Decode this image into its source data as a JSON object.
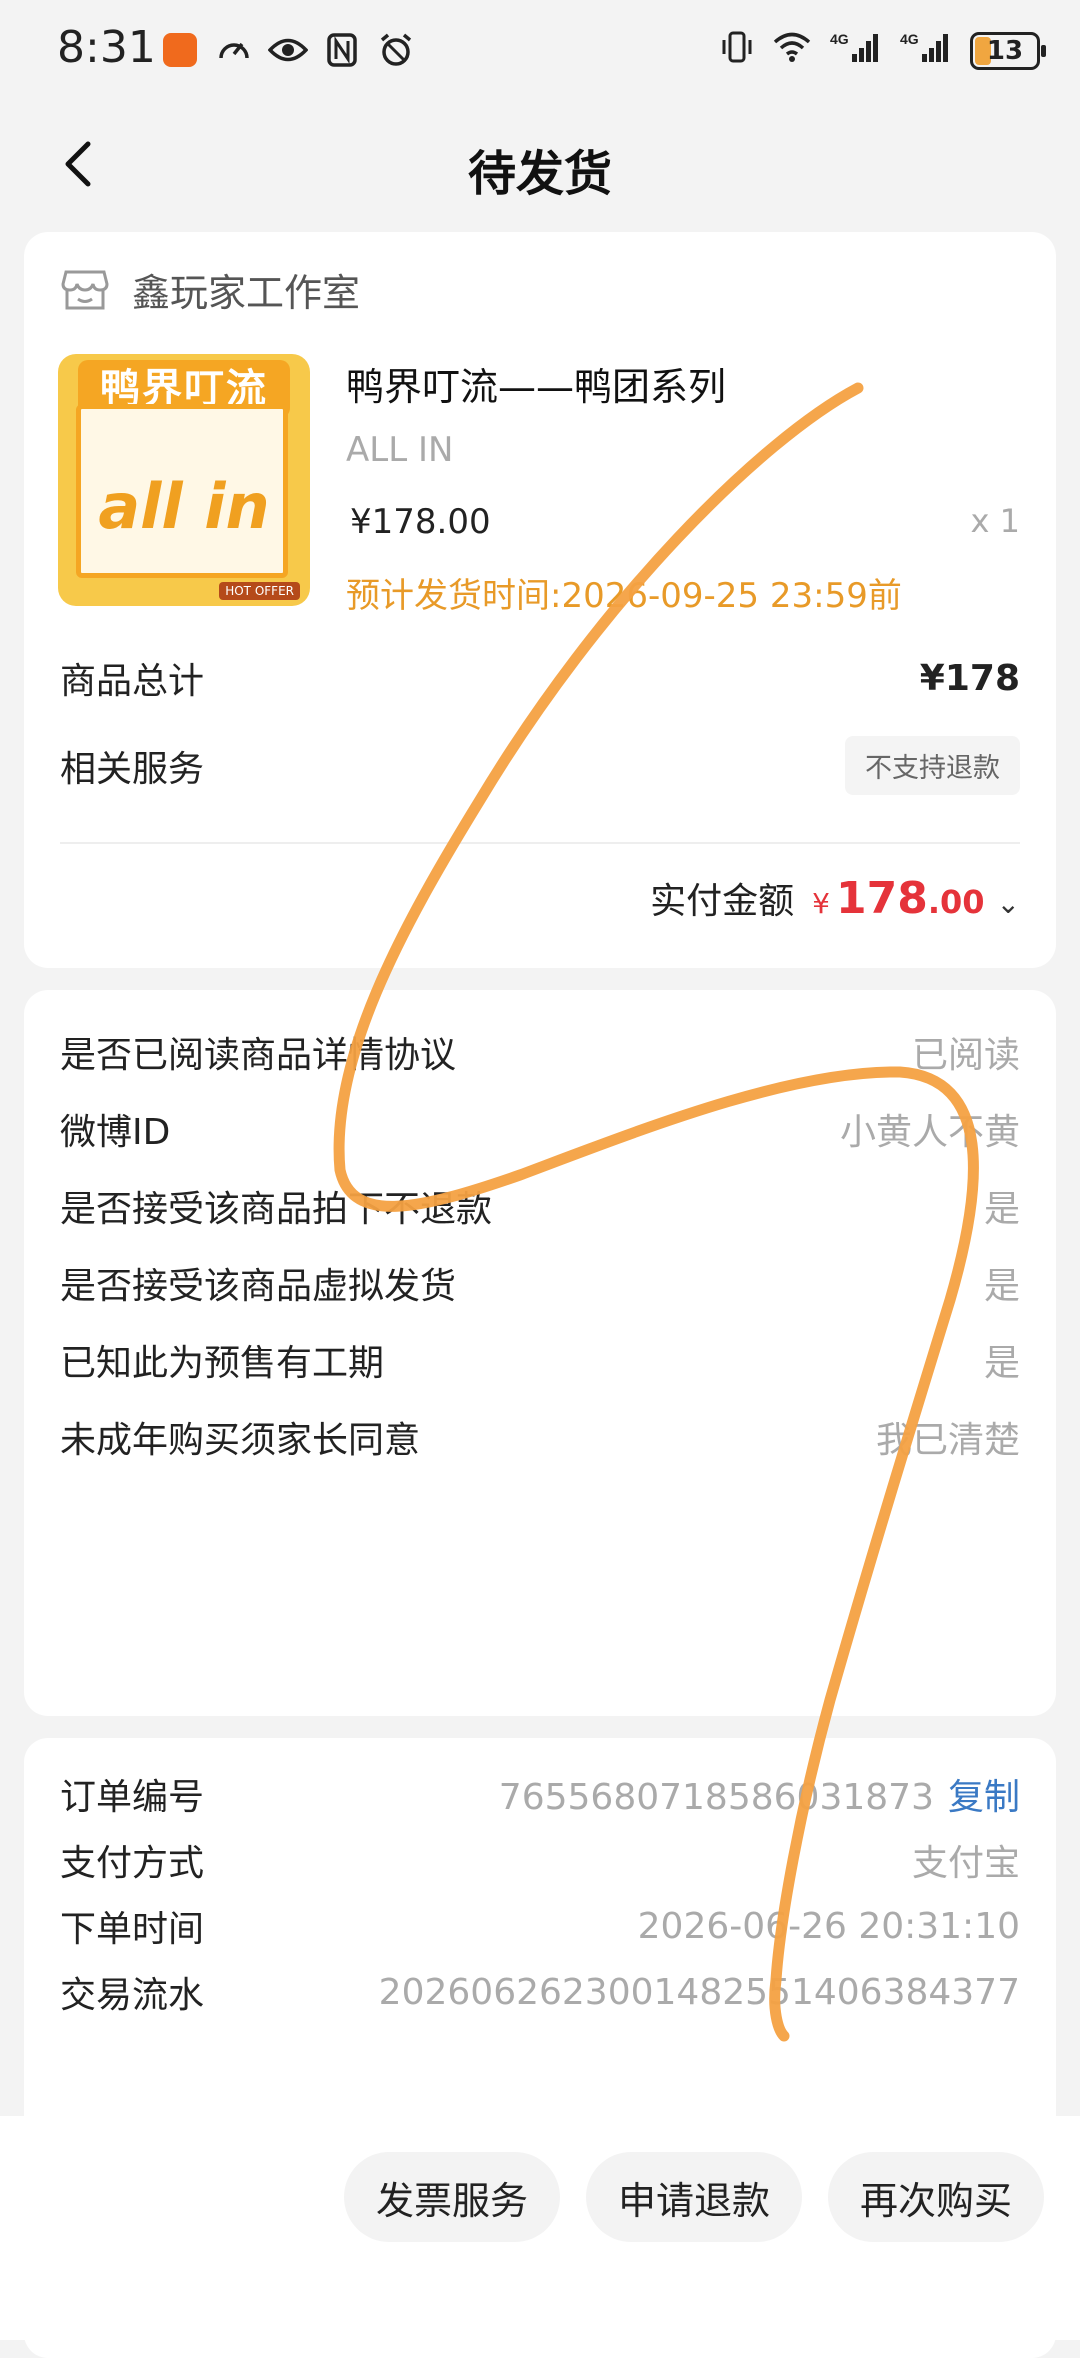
{
  "status_bar": {
    "time": "8:31",
    "network": "4G",
    "battery": "13",
    "icons": [
      "app-icon",
      "speedometer-icon",
      "eye-icon",
      "nfc-icon",
      "alarm-icon",
      "vibrate-icon",
      "wifi-icon",
      "signal-icon",
      "battery-icon"
    ]
  },
  "header": {
    "title": "待发货"
  },
  "order": {
    "shop_name": "鑫玩家工作室",
    "product": {
      "image_banner": "鸭界叮流",
      "image_text": "all in",
      "image_tag": "HOT OFFER",
      "title": "鸭界叮流——鸭团系列",
      "spec": "ALL IN",
      "price": "¥178.00",
      "qty": "x 1",
      "ship_time": "预计发货时间:2026-09-25 23:59前"
    },
    "goods_total_label": "商品总计",
    "goods_total_value": "¥178",
    "service_label": "相关服务",
    "service_tag": "不支持退款",
    "paid_label": "实付金额",
    "paid_symbol": "¥",
    "paid_int": "178",
    "paid_dec": ".00",
    "paid_chevron": "⌄"
  },
  "agreements": [
    {
      "label": "是否已阅读商品详情协议",
      "value": "已阅读"
    },
    {
      "label": "微博ID",
      "value": "小黄人不黄"
    },
    {
      "label": "是否接受该商品拍下不退款",
      "value": "是"
    },
    {
      "label": "是否接受该商品虚拟发货",
      "value": "是"
    },
    {
      "label": "已知此为预售有工期",
      "value": "是"
    },
    {
      "label": "未成年购买须家长同意",
      "value": "我已清楚"
    }
  ],
  "details": {
    "order_no_label": "订单编号",
    "order_no": "7655680718586031873",
    "copy": "复制",
    "pay_method_label": "支付方式",
    "pay_method": "支付宝",
    "order_time_label": "下单时间",
    "order_time": "2026-06-26 20:31:10",
    "txn_label": "交易流水",
    "txn": "2026062623001482551406384377"
  },
  "actions": {
    "invoice": "发票服务",
    "refund": "申请退款",
    "rebuy": "再次购买"
  },
  "colors": {
    "accent_red": "#e5333a",
    "ship_orange": "#e89a28",
    "link_blue": "#3a79c4",
    "scribble": "#f4a142"
  }
}
